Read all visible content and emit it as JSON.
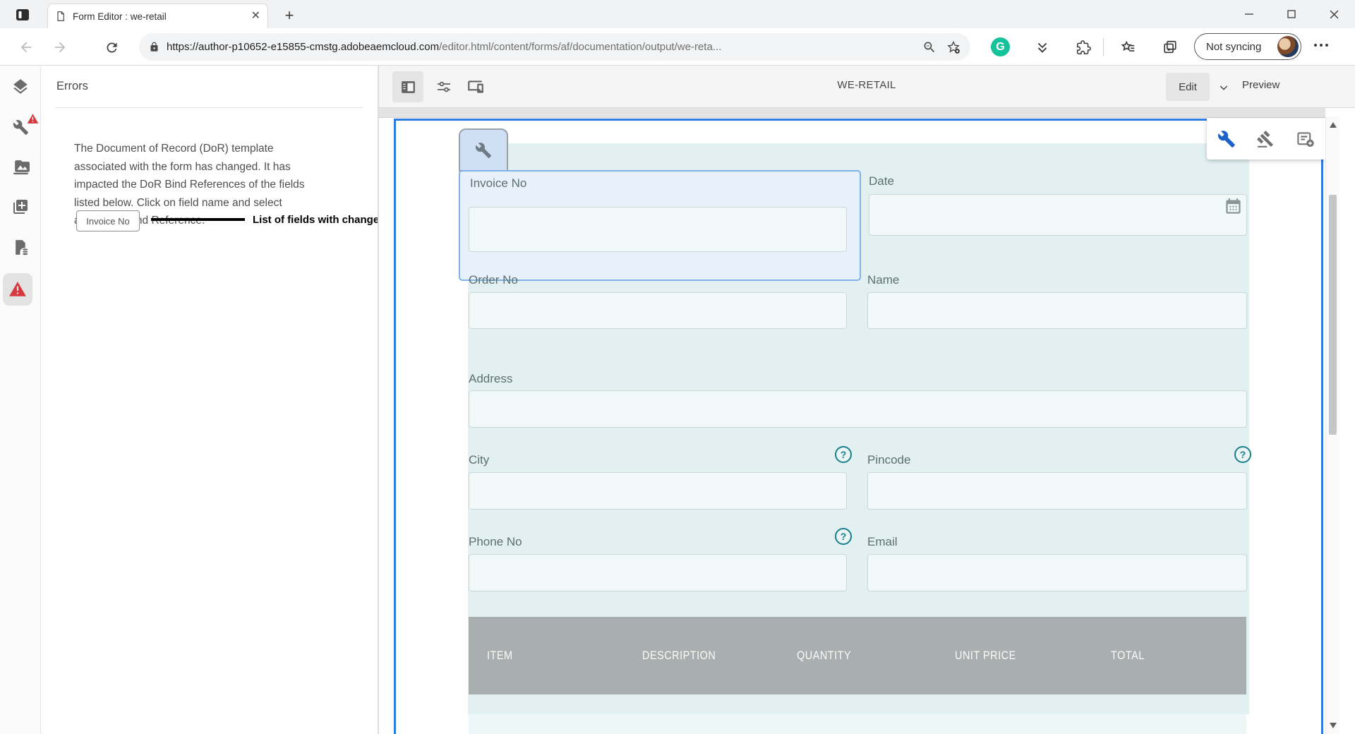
{
  "window": {
    "tab_title": "Form Editor : we-retail"
  },
  "browser": {
    "profile_label": "Not syncing"
  },
  "address_bar": {
    "url_host": "https://author-p10652-e15855-cmstg.adobeaemcloud.com",
    "url_path": "/editor.html/content/forms/af/documentation/output/we-reta..."
  },
  "errors_panel": {
    "title": "Errors",
    "message": "The Document of Record (DoR) template associated with the form has changed. It has impacted the DoR Bind References of the fields listed below. Click on field name and select applicable Bind Reference.",
    "field_button_label": "Invoice No",
    "annotation_label": "List of fields with changed bindings"
  },
  "editor": {
    "site_title": "WE-RETAIL",
    "edit_label": "Edit",
    "preview_label": "Preview"
  },
  "form": {
    "fields": {
      "invoice_no": "Invoice No",
      "date": "Date",
      "order_no": "Order No",
      "name": "Name",
      "address": "Address",
      "city": "City",
      "pincode": "Pincode",
      "phone_no": "Phone No",
      "email": "Email"
    },
    "help_glyph": "?",
    "table_headers": [
      "ITEM",
      "DESCRIPTION",
      "QUANTITY",
      "UNIT PRICE",
      "TOTAL"
    ]
  },
  "icons": {
    "rail": [
      "layers-icon",
      "wrench-warning-icon",
      "assets-icon",
      "components-icon",
      "data-sources-icon",
      "errors-warning-icon"
    ],
    "form_overlay": [
      "configure-wrench-icon",
      "edit-rules-gavel-icon",
      "add-panel-icon"
    ]
  },
  "colors": {
    "accent_blue": "#2e7ce0",
    "selection_blue": "#7fb2e5",
    "form_bg": "#e3f0f1",
    "input_bg": "#f0f8f8",
    "table_header_bg": "#a9aeae",
    "error_red": "#d7373f",
    "grammarly_green": "#15c39a",
    "help_teal": "#17808a"
  }
}
